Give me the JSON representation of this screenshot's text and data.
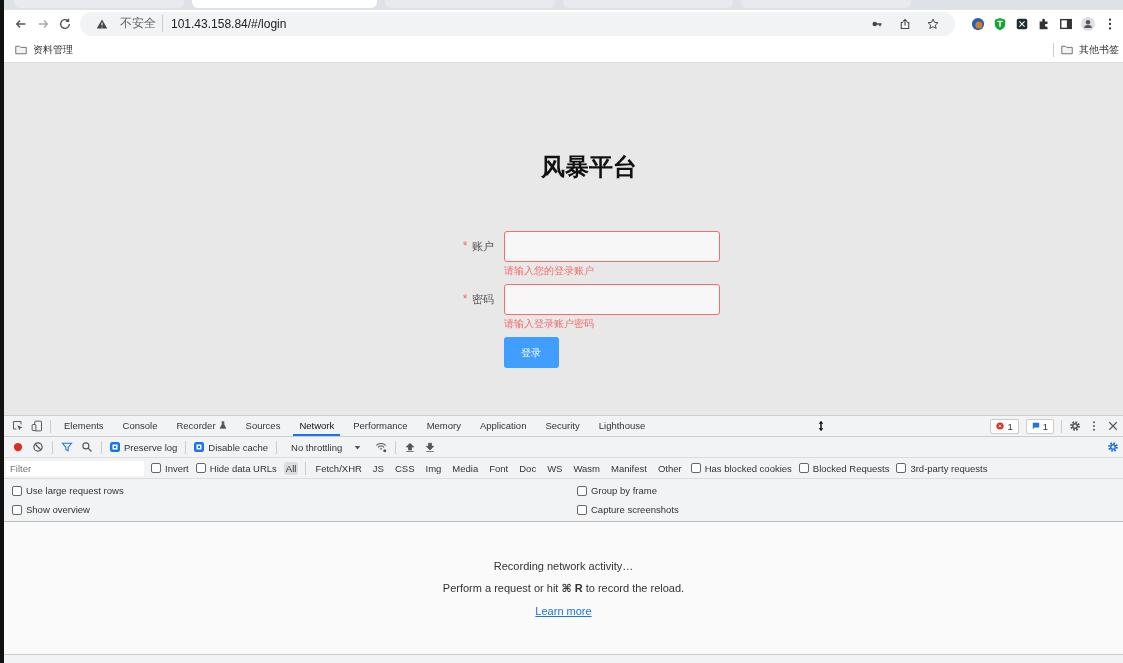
{
  "browser": {
    "tabs": [
      {
        "selected": false
      },
      {
        "selected": true
      },
      {
        "selected": false
      },
      {
        "selected": false
      },
      {
        "selected": false
      }
    ],
    "security_label": "不安全",
    "url": "101.43.158.84/#/login",
    "bookmarks": [
      {
        "label": "资料管理"
      }
    ],
    "other_bookmarks": "其他书签"
  },
  "page": {
    "title": "风暴平台",
    "fields": [
      {
        "label": "账户",
        "required_mark": "*",
        "error": "请输入您的登录账户"
      },
      {
        "label": "密码",
        "required_mark": "*",
        "error": "请输入登录账户密码"
      }
    ],
    "submit": "登录"
  },
  "devtools": {
    "tabs": [
      {
        "label": "Elements",
        "selected": false
      },
      {
        "label": "Console",
        "selected": false
      },
      {
        "label": "Recorder",
        "selected": false
      },
      {
        "label": "Sources",
        "selected": false
      },
      {
        "label": "Network",
        "selected": true
      },
      {
        "label": "Performance",
        "selected": false
      },
      {
        "label": "Memory",
        "selected": false
      },
      {
        "label": "Application",
        "selected": false
      },
      {
        "label": "Security",
        "selected": false
      },
      {
        "label": "Lighthouse",
        "selected": false
      }
    ],
    "error_count": "1",
    "message_count": "1",
    "recording": true,
    "toolbar_checks": [
      {
        "label": "Preserve log",
        "checked": true
      },
      {
        "label": "Disable cache",
        "checked": true
      }
    ],
    "throttling": "No throttling",
    "filter_placeholder": "Filter",
    "filter_checks": [
      {
        "label": "Invert",
        "checked": false
      },
      {
        "label": "Hide data URLs",
        "checked": false
      }
    ],
    "types": [
      {
        "label": "All",
        "selected": true
      },
      {
        "label": "Fetch/XHR",
        "selected": false
      },
      {
        "label": "JS",
        "selected": false
      },
      {
        "label": "CSS",
        "selected": false
      },
      {
        "label": "Img",
        "selected": false
      },
      {
        "label": "Media",
        "selected": false
      },
      {
        "label": "Font",
        "selected": false
      },
      {
        "label": "Doc",
        "selected": false
      },
      {
        "label": "WS",
        "selected": false
      },
      {
        "label": "Wasm",
        "selected": false
      },
      {
        "label": "Manifest",
        "selected": false
      },
      {
        "label": "Other",
        "selected": false
      }
    ],
    "more_checks": [
      {
        "label": "Has blocked cookies",
        "checked": false
      },
      {
        "label": "Blocked Requests",
        "checked": false
      },
      {
        "label": "3rd-party requests",
        "checked": false
      }
    ],
    "settings": [
      {
        "label": "Use large request rows",
        "checked": false
      },
      {
        "label": "Group by frame",
        "checked": false
      },
      {
        "label": "Show overview",
        "checked": false
      },
      {
        "label": "Capture screenshots",
        "checked": false
      }
    ],
    "empty_title": "Recording network activity…",
    "empty_hint": "Perform a request or hit **⌘ R** to record the reload.",
    "learn_more": "Learn more"
  }
}
